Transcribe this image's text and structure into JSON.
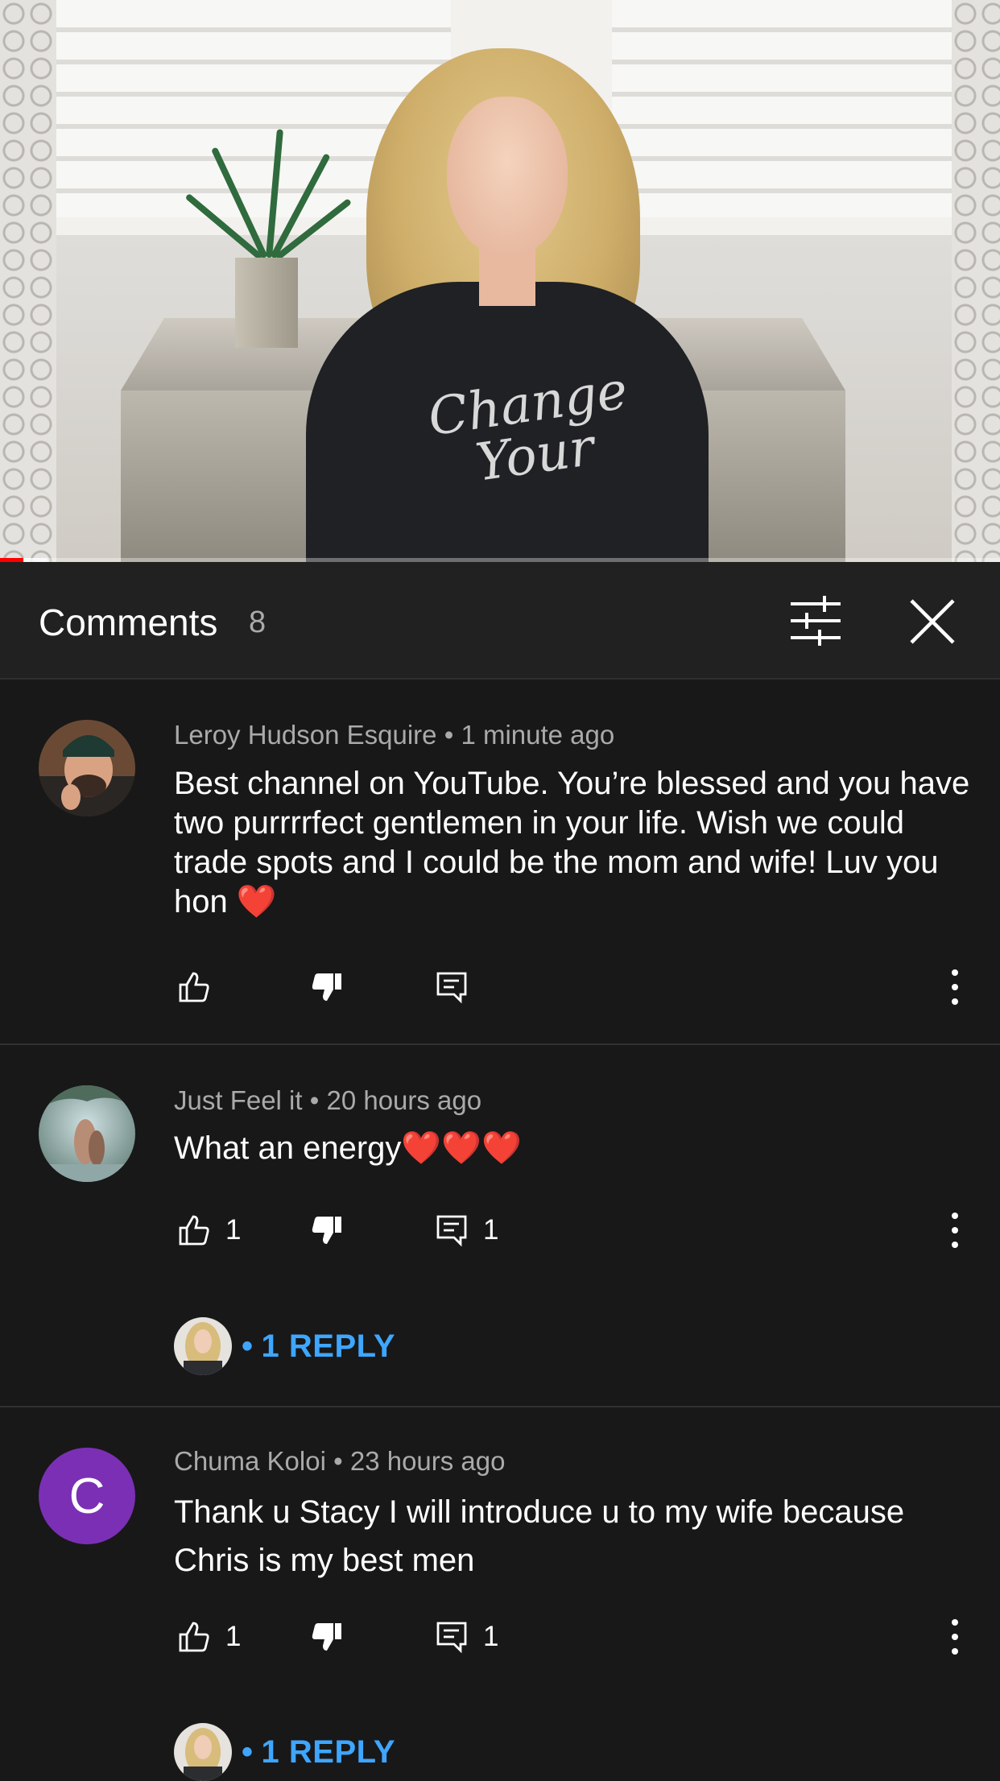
{
  "video": {
    "shirt_text": "Change Your",
    "progress_fraction": 0.023
  },
  "header": {
    "title": "Comments",
    "count": "8"
  },
  "comments": [
    {
      "author": "Leroy Hudson Esquire",
      "time": "1 minute ago",
      "text": "Best channel on YouTube. You’re blessed and you have two purrrrfect gentlemen in your life. Wish we could trade spots and I could be the mom and wife! Luv you hon ❤️",
      "likes": "",
      "replies_count": "",
      "reply_link": ""
    },
    {
      "author": "Just Feel it",
      "time": "20 hours ago",
      "text": "What an energy❤️❤️❤️",
      "likes": "1",
      "replies_count": "1",
      "reply_link": "1 REPLY"
    },
    {
      "author": "Chuma Koloi",
      "time": "23 hours ago",
      "avatar_letter": "C",
      "text": "Thank u Stacy I will introduce u to my wife because Chris is my best men",
      "likes": "1",
      "replies_count": "1",
      "reply_link": "1 REPLY"
    }
  ],
  "colors": {
    "background": "#181818",
    "header_background": "#212121",
    "link_blue": "#3ea6ff",
    "progress_red": "#ff0000",
    "avatar_purple": "#7b2fb5"
  },
  "icons": {
    "filter": "sliders-icon",
    "close": "close-icon",
    "like": "thumbs-up-icon",
    "dislike": "thumbs-down-icon",
    "reply": "comment-reply-icon",
    "more": "more-vertical-icon"
  }
}
